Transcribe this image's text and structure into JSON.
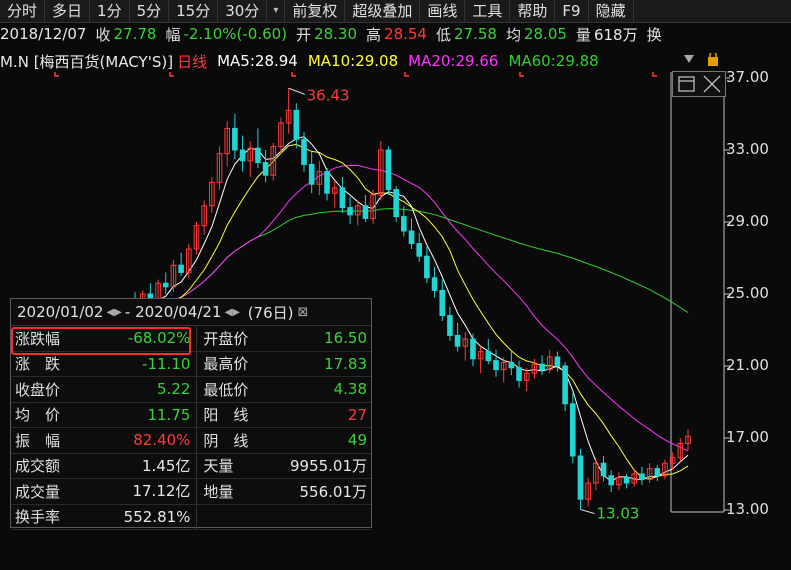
{
  "toolbar": [
    "分时",
    "多日",
    "1分",
    "5分",
    "15分",
    "30分",
    "▾",
    "前复权",
    "超级叠加",
    "画线",
    "工具",
    "帮助",
    "F9",
    "隐藏"
  ],
  "quote": {
    "date": "2018/12/07",
    "close_label": "收",
    "close": "27.78",
    "change_label": "幅",
    "change": "-2.10%(-0.60)",
    "open_label": "开",
    "open": "28.30",
    "high_label": "高",
    "high": "28.54",
    "low_label": "低",
    "low": "27.58",
    "avg_label": "均",
    "avg": "28.05",
    "vol_label": "量",
    "vol": "618万",
    "turn_label": "换"
  },
  "ma": {
    "name": "M.N [梅西百货(MACY'S)]",
    "period": "日线",
    "ma5": "MA5:28.94",
    "ma10": "MA10:29.08",
    "ma20": "MA20:29.66",
    "ma60": "MA60:29.88",
    "colors": {
      "ma5": "#ffffff",
      "ma10": "#ffff33",
      "ma20": "#ff33ff",
      "ma60": "#33cc33",
      "up": "#ff3a3a",
      "down": "#22d4d4"
    }
  },
  "price_axis": [
    "37.00",
    "33.00",
    "29.00",
    "25.00",
    "21.00",
    "17.00",
    "13.00"
  ],
  "annotations": {
    "high": "36.43",
    "low": "13.03"
  },
  "panel": {
    "start": "2020/01/02",
    "sep": "-",
    "end": "2020/04/21",
    "days": "(76日)",
    "rows": [
      {
        "l1": "涨跌幅",
        "v1": "-68.02%",
        "c1": "green",
        "l2": "开盘价",
        "v2": "16.50",
        "c2": "green"
      },
      {
        "l1": "涨　跌",
        "v1": "-11.10",
        "c1": "green",
        "l2": "最高价",
        "v2": "17.83",
        "c2": "green"
      },
      {
        "l1": "收盘价",
        "v1": "5.22",
        "c1": "green",
        "l2": "最低价",
        "v2": "4.38",
        "c2": "green"
      },
      {
        "l1": "均　价",
        "v1": "11.75",
        "c1": "green",
        "l2": "阳　线",
        "v2": "27",
        "c2": "red"
      },
      {
        "l1": "振　幅",
        "v1": "82.40%",
        "c1": "red",
        "l2": "阴　线",
        "v2": "49",
        "c2": "green"
      },
      {
        "l1": "成交额",
        "v1": "1.45亿",
        "c1": "white",
        "l2": "天量",
        "v2": "9955.01万",
        "c2": "white"
      },
      {
        "l1": "成交量",
        "v1": "17.12亿",
        "c1": "white",
        "l2": "地量",
        "v2": "556.01万",
        "c2": "white"
      },
      {
        "l1": "换手率",
        "v1": "552.81%",
        "c1": "white",
        "l2": "",
        "v2": "",
        "c2": "white"
      }
    ]
  },
  "chart_data": {
    "type": "line",
    "ylim": [
      13,
      37
    ],
    "candles": [
      [
        22.8,
        23.9,
        22.2,
        23.5
      ],
      [
        23.5,
        24.0,
        22.9,
        23.1
      ],
      [
        23.1,
        24.6,
        22.8,
        24.3
      ],
      [
        24.3,
        25.1,
        23.6,
        23.9
      ],
      [
        23.9,
        25.2,
        23.5,
        25.0
      ],
      [
        25.0,
        25.6,
        24.2,
        24.5
      ],
      [
        24.5,
        25.8,
        24.3,
        25.6
      ],
      [
        25.6,
        26.2,
        25.0,
        25.4
      ],
      [
        25.4,
        26.9,
        25.1,
        26.6
      ],
      [
        26.6,
        27.3,
        26.0,
        26.2
      ],
      [
        26.2,
        27.8,
        25.9,
        27.5
      ],
      [
        27.5,
        29.0,
        27.2,
        28.8
      ],
      [
        28.8,
        30.2,
        28.3,
        29.9
      ],
      [
        29.9,
        31.5,
        29.5,
        31.2
      ],
      [
        31.2,
        33.2,
        30.8,
        32.8
      ],
      [
        32.8,
        34.6,
        32.1,
        34.2
      ],
      [
        34.2,
        35.0,
        32.5,
        33.0
      ],
      [
        33.0,
        33.8,
        31.8,
        32.4
      ],
      [
        32.4,
        33.5,
        31.5,
        33.1
      ],
      [
        33.1,
        34.2,
        32.0,
        32.3
      ],
      [
        32.3,
        33.0,
        31.2,
        31.6
      ],
      [
        31.6,
        33.4,
        31.3,
        33.2
      ],
      [
        33.2,
        34.8,
        32.8,
        34.5
      ],
      [
        34.5,
        36.43,
        33.9,
        35.2
      ],
      [
        35.2,
        35.6,
        33.1,
        33.6
      ],
      [
        33.6,
        34.0,
        31.8,
        32.2
      ],
      [
        32.2,
        32.9,
        30.6,
        31.1
      ],
      [
        31.1,
        32.4,
        30.5,
        31.8
      ],
      [
        31.8,
        32.0,
        30.2,
        30.6
      ],
      [
        30.6,
        31.3,
        29.8,
        30.9
      ],
      [
        30.9,
        31.5,
        29.5,
        29.8
      ],
      [
        29.8,
        30.4,
        28.9,
        29.4
      ],
      [
        29.4,
        30.2,
        28.8,
        29.9
      ],
      [
        29.9,
        30.5,
        29.0,
        29.2
      ],
      [
        29.2,
        30.8,
        28.9,
        30.5
      ],
      [
        30.5,
        33.5,
        30.2,
        33.0
      ],
      [
        33.0,
        33.2,
        30.5,
        30.8
      ],
      [
        30.8,
        31.0,
        29.0,
        29.3
      ],
      [
        29.3,
        29.9,
        28.2,
        28.5
      ],
      [
        28.5,
        29.2,
        27.5,
        27.8
      ],
      [
        27.8,
        28.4,
        26.8,
        27.1
      ],
      [
        27.1,
        27.6,
        25.6,
        25.9
      ],
      [
        25.9,
        26.5,
        24.8,
        25.2
      ],
      [
        25.2,
        25.8,
        23.5,
        23.8
      ],
      [
        23.8,
        24.3,
        22.4,
        22.7
      ],
      [
        22.7,
        23.4,
        21.8,
        22.1
      ],
      [
        22.1,
        22.9,
        21.3,
        22.5
      ],
      [
        22.5,
        22.8,
        21.0,
        21.4
      ],
      [
        21.4,
        22.1,
        20.6,
        21.8
      ],
      [
        21.8,
        22.5,
        21.1,
        21.3
      ],
      [
        21.3,
        21.9,
        20.4,
        20.8
      ],
      [
        20.8,
        21.5,
        20.1,
        21.2
      ],
      [
        21.2,
        21.8,
        20.5,
        20.9
      ],
      [
        20.9,
        21.3,
        19.8,
        20.2
      ],
      [
        20.2,
        20.9,
        19.6,
        20.6
      ],
      [
        20.6,
        21.4,
        20.3,
        21.1
      ],
      [
        21.1,
        21.6,
        20.5,
        20.8
      ],
      [
        20.8,
        21.9,
        20.6,
        21.5
      ],
      [
        21.5,
        21.8,
        20.7,
        21.0
      ],
      [
        21.0,
        21.2,
        18.5,
        18.9
      ],
      [
        18.9,
        19.5,
        15.6,
        16.0
      ],
      [
        16.0,
        16.4,
        13.03,
        13.6
      ],
      [
        13.6,
        14.8,
        13.2,
        14.5
      ],
      [
        14.5,
        15.9,
        14.1,
        15.6
      ],
      [
        15.6,
        16.0,
        14.6,
        14.9
      ],
      [
        14.9,
        15.2,
        14.0,
        14.4
      ],
      [
        14.4,
        15.1,
        14.1,
        14.8
      ],
      [
        14.8,
        15.0,
        14.2,
        14.5
      ],
      [
        14.5,
        15.3,
        14.3,
        15.0
      ],
      [
        15.0,
        15.4,
        14.4,
        14.7
      ],
      [
        14.7,
        15.6,
        14.5,
        15.3
      ],
      [
        15.3,
        15.5,
        14.6,
        14.9
      ],
      [
        14.9,
        15.8,
        14.7,
        15.6
      ],
      [
        15.6,
        16.2,
        15.2,
        15.9
      ],
      [
        15.9,
        17.0,
        15.7,
        16.7
      ],
      [
        16.7,
        17.5,
        16.3,
        17.1
      ]
    ]
  }
}
